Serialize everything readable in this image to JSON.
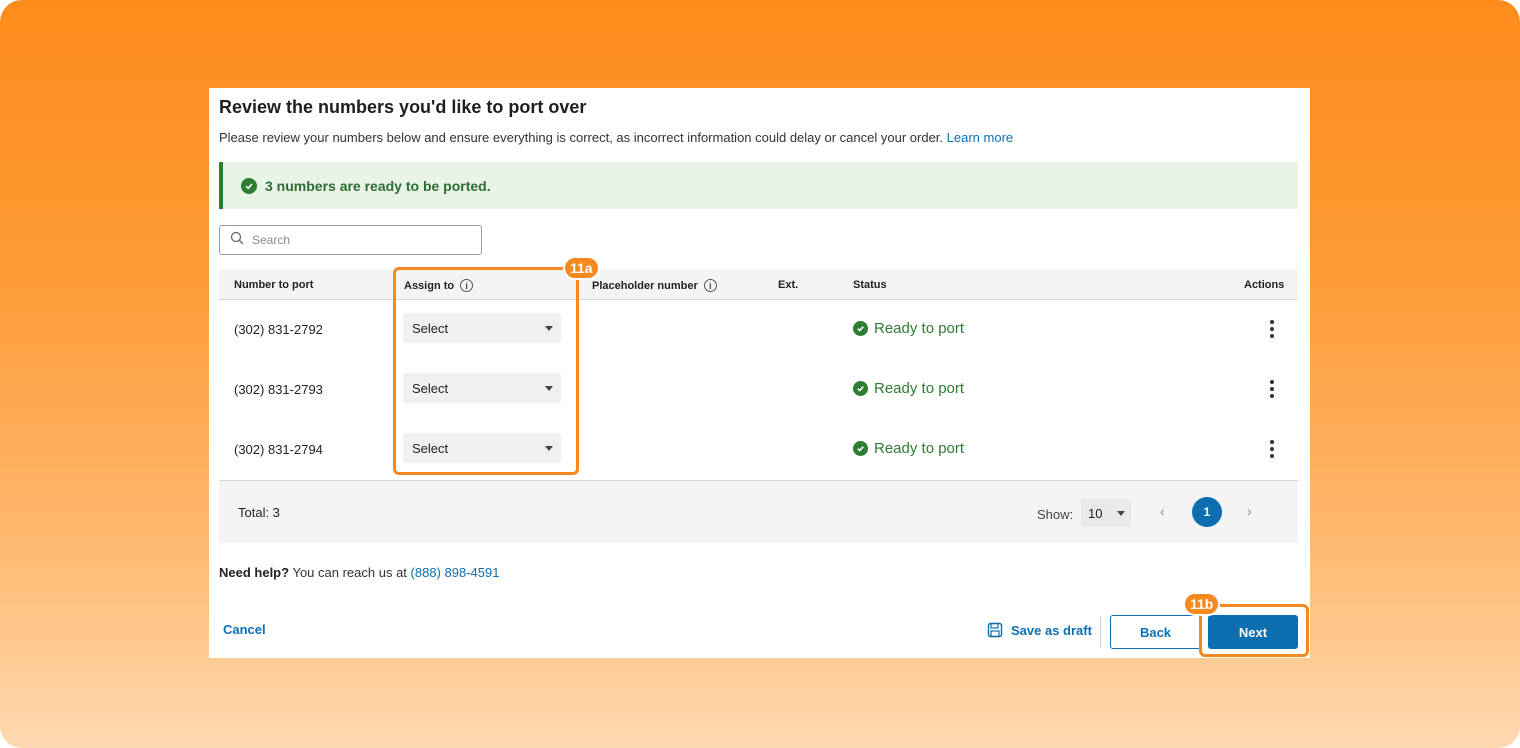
{
  "page": {
    "title": "Review the numbers you'd like to port over",
    "subtitle": "Please review your numbers below and ensure everything is correct, as incorrect information could delay or cancel your order.",
    "learn_more": "Learn more"
  },
  "banner": {
    "text": "3 numbers are ready to be ported."
  },
  "search": {
    "placeholder": "Search"
  },
  "table": {
    "headers": {
      "number": "Number to port",
      "assign": "Assign to",
      "placeholder": "Placeholder number",
      "ext": "Ext.",
      "status": "Status",
      "actions": "Actions"
    },
    "rows": [
      {
        "number": "(302) 831-2792",
        "assign": "Select",
        "status": "Ready to port"
      },
      {
        "number": "(302) 831-2793",
        "assign": "Select",
        "status": "Ready to port"
      },
      {
        "number": "(302) 831-2794",
        "assign": "Select",
        "status": "Ready to port"
      }
    ],
    "footer": {
      "total": "Total: 3",
      "show_label": "Show:",
      "show_value": "10",
      "current_page": "1"
    }
  },
  "help": {
    "bold": "Need help?",
    "text": "You can reach us at",
    "phone": "(888) 898-4591"
  },
  "actions": {
    "cancel": "Cancel",
    "save_draft": "Save as draft",
    "back": "Back",
    "next": "Next"
  },
  "annotations": {
    "a": "11a",
    "b": "11b"
  },
  "colors": {
    "accent": "#0e6fb0",
    "success": "#2e7d32",
    "highlight": "#f5881f"
  }
}
